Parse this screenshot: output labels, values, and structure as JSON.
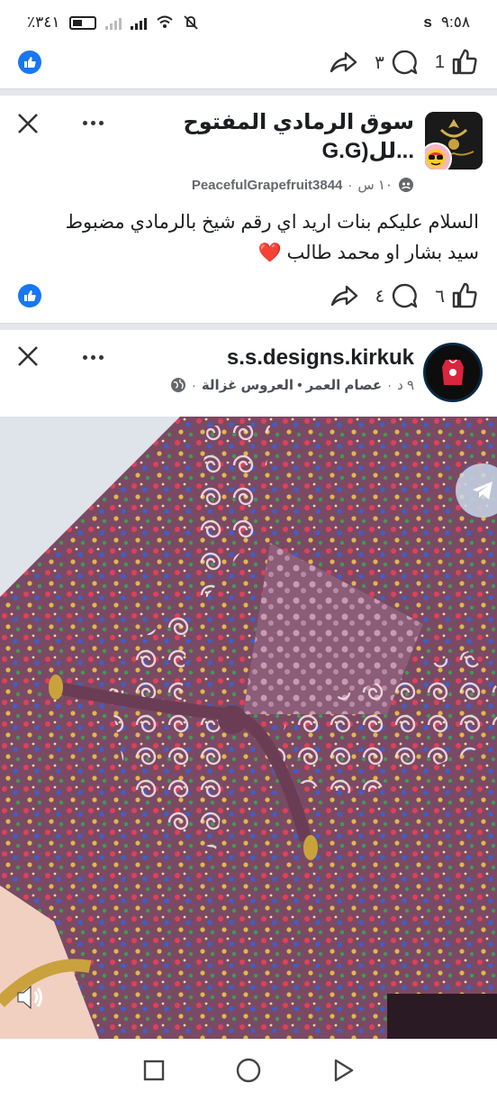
{
  "status_bar": {
    "time": "٩:٥٨",
    "carrier_icon": "s",
    "battery": "٪٣٤١"
  },
  "top_actions": {
    "like_count": "1",
    "comment_count": "٣"
  },
  "post1": {
    "group_name_line1": "سوق الرمادي المفتوح",
    "group_name_line2": "G.G)لل...",
    "author": "PeacefulGrapefruit3844",
    "time": "١٠ س",
    "text_line1": "السلام عليكم بنات اريد اي رقم شيخ بالرمادي مضبوط",
    "text_line2": "سيد بشار او محمد طالب",
    "text_emoji": "❤️",
    "like_count": "٦",
    "comment_count": "٤"
  },
  "post2": {
    "page_name": "s.s.designs.kirkuk",
    "time": "٩ د",
    "meta": "عصام العمر • العروس غزالة"
  },
  "colors": {
    "accent": "#1877f2",
    "emoji_heart": "#e41e3f"
  },
  "icons": [
    "like-icon",
    "comment-icon",
    "share-icon",
    "close-icon",
    "more-icon",
    "globe-icon",
    "sound-icon",
    "telegram-icon",
    "square-nav-icon",
    "circle-nav-icon",
    "triangle-nav-icon"
  ]
}
